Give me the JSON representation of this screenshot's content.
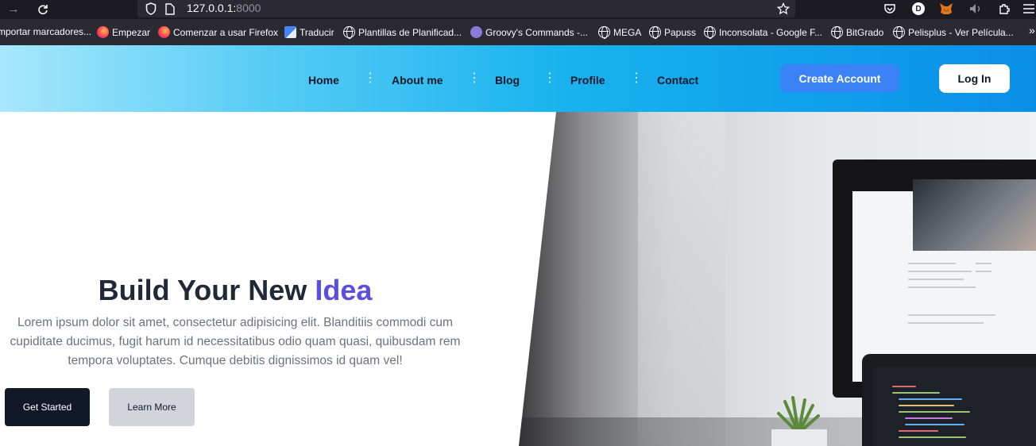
{
  "browser": {
    "url_host": "127.0.0.1:",
    "url_port": "8000",
    "bookmarks": [
      {
        "label": "mportar marcadores...",
        "icon": "import-icon"
      },
      {
        "label": "Empezar",
        "icon": "firefox-icon"
      },
      {
        "label": "Comenzar a usar Firefox",
        "icon": "firefox-icon"
      },
      {
        "label": "Traducir",
        "icon": "google-translate-icon"
      },
      {
        "label": "Plantillas de Planificad...",
        "icon": "globe-icon"
      },
      {
        "label": "Groovy's Commands -...",
        "icon": "groovy-icon"
      },
      {
        "label": "MEGA",
        "icon": "globe-icon"
      },
      {
        "label": "Papuss",
        "icon": "globe-icon"
      },
      {
        "label": "Inconsolata - Google F...",
        "icon": "globe-icon"
      },
      {
        "label": "BitGrado",
        "icon": "globe-icon"
      },
      {
        "label": "Pelisplus - Ver Película...",
        "icon": "globe-icon"
      }
    ],
    "overflow_label": "»"
  },
  "nav": {
    "links": [
      "Home",
      "About me",
      "Blog",
      "Profile",
      "Contact"
    ],
    "create_account": "Create Account",
    "login": "Log In"
  },
  "hero": {
    "title_main": "Build Your New ",
    "title_accent": "Idea",
    "description": "Lorem ipsum dolor sit amet, consectetur adipisicing elit. Blanditiis commodi cum cupiditate ducimus, fugit harum id necessitatibus odio quam quasi, quibusdam rem tempora voluptates. Cumque debitis dignissimos id quam vel!",
    "primary_button": "Get Started",
    "secondary_button": "Learn More"
  },
  "colors": {
    "accent": "#5b4fe0",
    "create_button": "#3b82f6",
    "primary_button": "#111827",
    "secondary_button": "#d1d5db"
  }
}
